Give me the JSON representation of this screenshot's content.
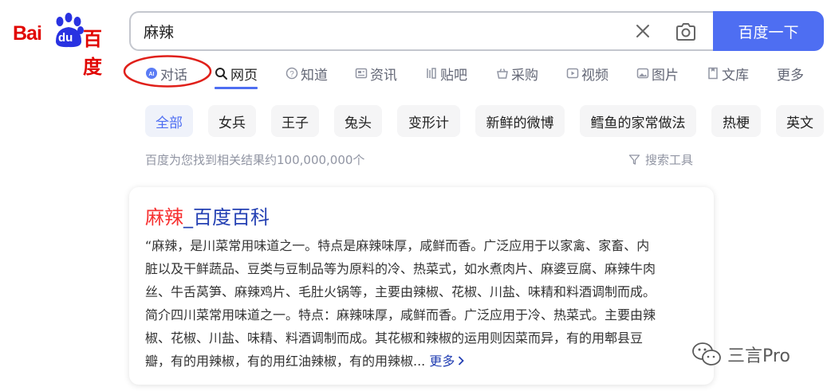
{
  "logo": {
    "latin": "Bai",
    "du": "du",
    "chinese": "百度",
    "color": "#e10602"
  },
  "search": {
    "query": "麻辣",
    "button_label": "百度一下",
    "accent": "#4e6ef2"
  },
  "tabs": [
    {
      "label": "对话",
      "icon": "ai-chat-icon"
    },
    {
      "label": "网页",
      "icon": "search-icon",
      "active": true
    },
    {
      "label": "知道",
      "icon": "question-icon"
    },
    {
      "label": "资讯",
      "icon": "news-icon"
    },
    {
      "label": "贴吧",
      "icon": "tieba-icon"
    },
    {
      "label": "采购",
      "icon": "basket-icon"
    },
    {
      "label": "视频",
      "icon": "video-icon"
    },
    {
      "label": "图片",
      "icon": "image-icon"
    },
    {
      "label": "文库",
      "icon": "doc-icon"
    },
    {
      "label": "更多"
    }
  ],
  "chips": [
    "全部",
    "女兵",
    "王子",
    "兔头",
    "变形计",
    "新鲜的微博",
    "鳕鱼的家常做法",
    "热梗",
    "英文"
  ],
  "result_info": {
    "count_text": "百度为您找到相关结果约100,000,000个",
    "tools_label": "搜索工具"
  },
  "result": {
    "title_keyword": "麻辣",
    "title_rest": "_百度百科",
    "lines": [
      "“麻辣，是川菜常用味道之一。特点是麻辣味厚，咸鲜而香。广泛应用于以家禽、家畜、内",
      "脏以及干鲜蔬品、豆类与豆制品等为原料的冷、热菜式，如水煮肉片、麻婆豆腐、麻辣牛肉",
      "丝、牛舌莴笋、麻辣鸡片、毛肚火锅等，主要由辣椒、花椒、川盐、味精和料酒调制而成。",
      "简介四川菜常用味道之一。特点：麻辣味厚，咸鲜而香。广泛应用于冷、热菜式。主要由辣",
      "椒、花椒、川盐、味精、料酒调制而成。其花椒和辣椒的运用则因菜而异，有的用郫县豆",
      "瓣，有的用辣椒，有的用红油辣椒，有的用辣椒..."
    ],
    "more_label": "更多"
  },
  "watermark": {
    "text": "三言Pro",
    "icon": "wechat-icon"
  }
}
